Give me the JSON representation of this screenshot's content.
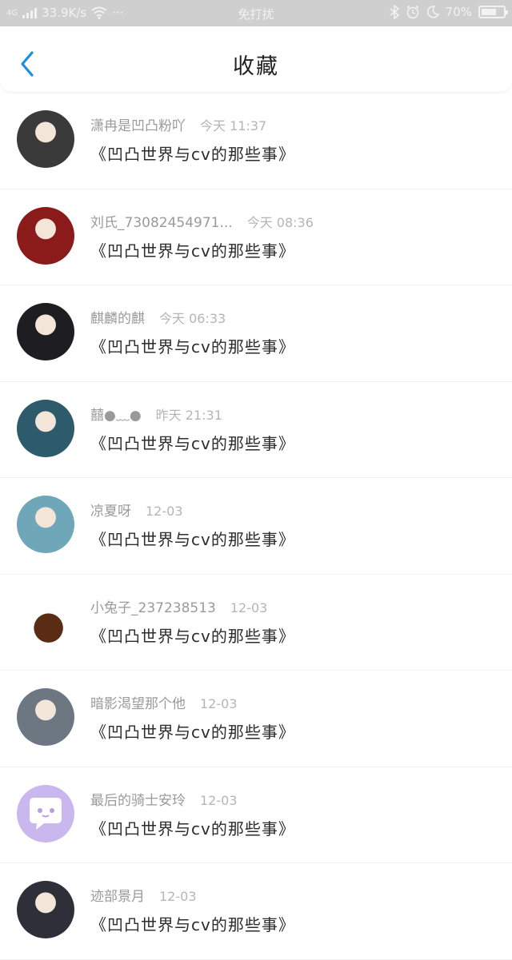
{
  "status_bar": {
    "net_type": "4G",
    "speed": "33.9K/s",
    "dots": "···",
    "mode": "免打扰",
    "battery": "70%",
    "battery_level": 0.7
  },
  "header": {
    "title": "收藏"
  },
  "items": [
    {
      "user": "潇冉是凹凸粉吖",
      "time": "今天 11:37",
      "subject": "《凹凸世界与cv的那些事》",
      "avatar_color": "#3a3a3a"
    },
    {
      "user": "刘氏_73082454971...",
      "time": "今天 08:36",
      "subject": "《凹凸世界与cv的那些事》",
      "avatar_color": "#8b1a1a"
    },
    {
      "user": "麒麟的麒",
      "time": "今天 06:33",
      "subject": "《凹凸世界与cv的那些事》",
      "avatar_color": "#1e1e22"
    },
    {
      "user": "囍●﹏●",
      "time": "昨天 21:31",
      "subject": "《凹凸世界与cv的那些事》",
      "avatar_color": "#2d5b6b"
    },
    {
      "user": "凉夏呀",
      "time": "12-03",
      "subject": "《凹凸世界与cv的那些事》",
      "avatar_color": "#6fa7b8"
    },
    {
      "user": "小兔子_237238513",
      "time": "12-03",
      "subject": "《凹凸世界与cv的那些事》",
      "avatar_color": "#ffffff"
    },
    {
      "user": "暗影渴望那个他",
      "time": "12-03",
      "subject": "《凹凸世界与cv的那些事》",
      "avatar_color": "#6c7782"
    },
    {
      "user": "最后的骑士安玲",
      "time": "12-03",
      "subject": "《凹凸世界与cv的那些事》",
      "avatar_color": "#c9b7ee"
    },
    {
      "user": "迹部景月",
      "time": "12-03",
      "subject": "《凹凸世界与cv的那些事》",
      "avatar_color": "#2f2f3a"
    }
  ]
}
